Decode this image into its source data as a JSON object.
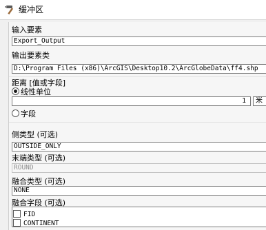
{
  "window": {
    "title": "缓冲区",
    "icon": "hammer-icon"
  },
  "input_features": {
    "label": "输入要素",
    "value": "Export_Output"
  },
  "output_features": {
    "label": "输出要素类",
    "value": "D:\\Program Files (x86)\\ArcGIS\\Desktop10.2\\ArcGlobeData\\ff4.shp"
  },
  "distance": {
    "label": "距离 [值或字段]",
    "linear_unit_label": "线性单位",
    "linear_unit_selected": true,
    "value": "1",
    "unit": "米",
    "field_label": "字段",
    "field_selected": false
  },
  "side_type": {
    "label": "侧类型 (可选)",
    "value": "OUTSIDE_ONLY"
  },
  "end_type": {
    "label": "末端类型 (可选)",
    "value": "ROUND",
    "enabled": false
  },
  "dissolve_type": {
    "label": "融合类型 (可选)",
    "value": "NONE"
  },
  "dissolve_field": {
    "label": "融合字段 (可选)",
    "options": [
      {
        "label": "FID",
        "checked": false
      },
      {
        "label": "CONTINENT",
        "checked": false
      }
    ]
  }
}
